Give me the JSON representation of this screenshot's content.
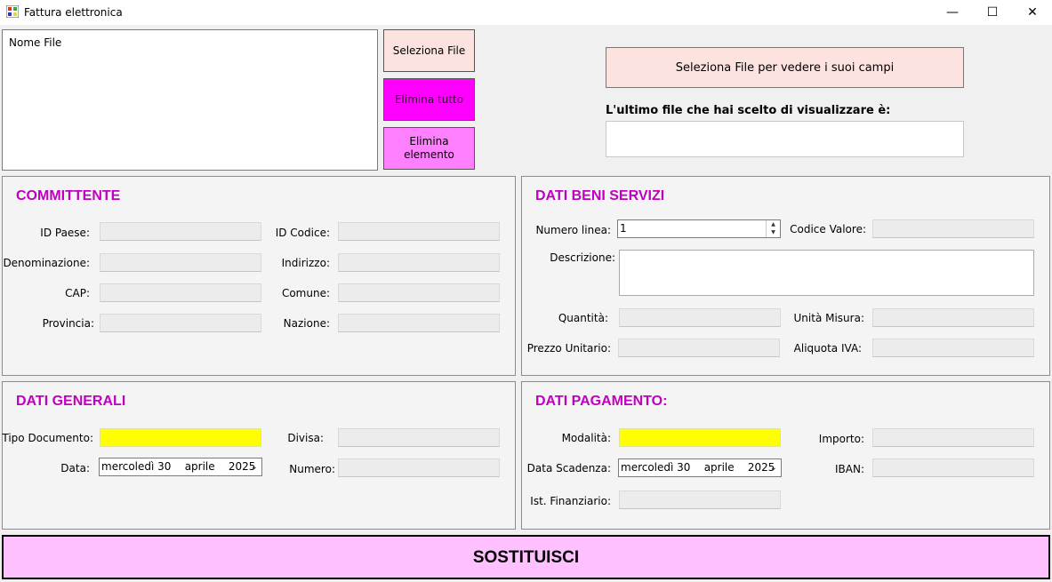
{
  "window": {
    "title": "Fattura elettronica",
    "minimize": "—",
    "maximize": "☐",
    "close": "✕"
  },
  "file_list": {
    "header": "Nome File"
  },
  "buttons": {
    "select_file": "Seleziona File",
    "delete_all": "Elimina tutto",
    "delete_element": "Elimina elemento",
    "view_fields": "Seleziona File per vedere i suoi campi",
    "replace": "SOSTITUISCI"
  },
  "last_file": {
    "label": "L'ultimo file che hai scelto di visualizzare è:",
    "value": ""
  },
  "committente": {
    "title": "COMMITTENTE",
    "id_paese": "ID Paese:",
    "id_codice": "ID Codice:",
    "denominazione": "Denominazione:",
    "indirizzo": "Indirizzo:",
    "cap": "CAP:",
    "comune": "Comune:",
    "provincia": "Provincia:",
    "nazione": "Nazione:"
  },
  "beni_servizi": {
    "title": "DATI BENI SERVIZI",
    "numero_linea": "Numero linea:",
    "numero_linea_value": "1",
    "codice_valore": "Codice Valore:",
    "descrizione": "Descrizione:",
    "quantita": "Quantità:",
    "unita_misura": "Unità Misura:",
    "prezzo_unitario": "Prezzo Unitario:",
    "aliquota_iva": "Aliquota IVA:"
  },
  "dati_generali": {
    "title": "DATI GENERALI",
    "tipo_documento": "Tipo Documento:",
    "divisa": "Divisa:",
    "data": "Data:",
    "data_value": "mercoledì 30    aprile    2025",
    "numero": "Numero:"
  },
  "dati_pagamento": {
    "title": "DATI PAGAMENTO:",
    "modalita": "Modalità:",
    "importo": "Importo:",
    "data_scadenza": "Data Scadenza:",
    "data_scadenza_value": "mercoledì 30    aprile    2025",
    "iban": "IBAN:",
    "ist_finanziario": "Ist. Finanziario:"
  },
  "colors": {
    "accent_title": "#c000c0",
    "highlight_field": "#ffff00",
    "delete_all_bg": "#ff00ff",
    "delete_element_bg": "#ff80ff",
    "replace_bg": "#ffc0ff",
    "select_bg": "#fde3e0"
  }
}
